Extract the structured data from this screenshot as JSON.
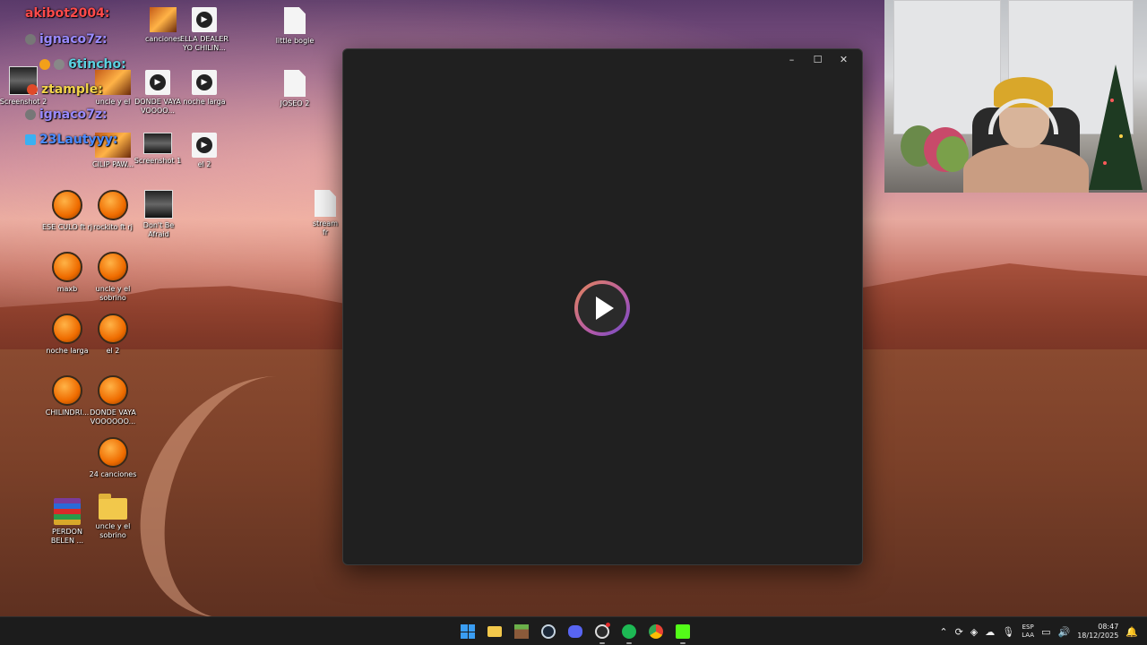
{
  "chat": {
    "lines": [
      {
        "user": "akibot2004:",
        "color": "#ff4a4a"
      },
      {
        "user": "ignaco7z:",
        "color": "#9a8aff"
      },
      {
        "user": "6tincho:",
        "color": "#5ad1e0"
      },
      {
        "user": "ztample:",
        "color": "#f2d34a"
      },
      {
        "user": "ignaco7z:",
        "color": "#9a8aff"
      },
      {
        "user": "23Lautyyy:",
        "color": "#4a8aff"
      }
    ]
  },
  "desktop": {
    "icons": {
      "canciones": "canciones",
      "ella_dealer": "ELLA DEALER YO CHILIN...",
      "little_bogie": "little bogie",
      "uncle_y_el": "uncle y el",
      "donde_vaya_top": "DONDE VAYA VOOOO...",
      "noche_larga_top": "noche larga",
      "joseo2": "JOSEO 2",
      "screenshot2": "Screenshot 2",
      "screenshot1": "Screenshot 1",
      "el2_top": "el 2",
      "capipaw": "CILIP PAW...",
      "ese_culo": "ESE CULO ft rj",
      "rockito": "rockito ft rj",
      "dont_be_afraid": "Don't Be Afraid",
      "stream": "stream fr",
      "maxb": "maxb",
      "uncle_y_el_sobrino": "uncle y el sobrino",
      "noche_larga": "noche larga",
      "el2": "el 2",
      "chilindri": "CHILINDRI...",
      "donde_vaya": "DONDE VAYA VOOOOOO...",
      "canciones24": "24 canciones",
      "perdon_belen": "PERDON BELEN ...",
      "uncle_folder": "uncle y el sobrino"
    }
  },
  "player": {
    "minimize": "–",
    "maximize": "☐",
    "close": "✕"
  },
  "taskbar": {
    "apps": [
      "start-icon",
      "file-explorer-icon",
      "minecraft-icon",
      "steam-icon",
      "discord-icon",
      "obs-icon",
      "spotify-icon",
      "chrome-icon",
      "kick-icon"
    ],
    "lang_top": "ESP",
    "lang_bottom": "LAA",
    "time": "08:47",
    "date": "18/12/2025"
  },
  "colors": {
    "window_bg": "#202020",
    "accent_blue": "#3a9df2",
    "spotify": "#1db954"
  }
}
